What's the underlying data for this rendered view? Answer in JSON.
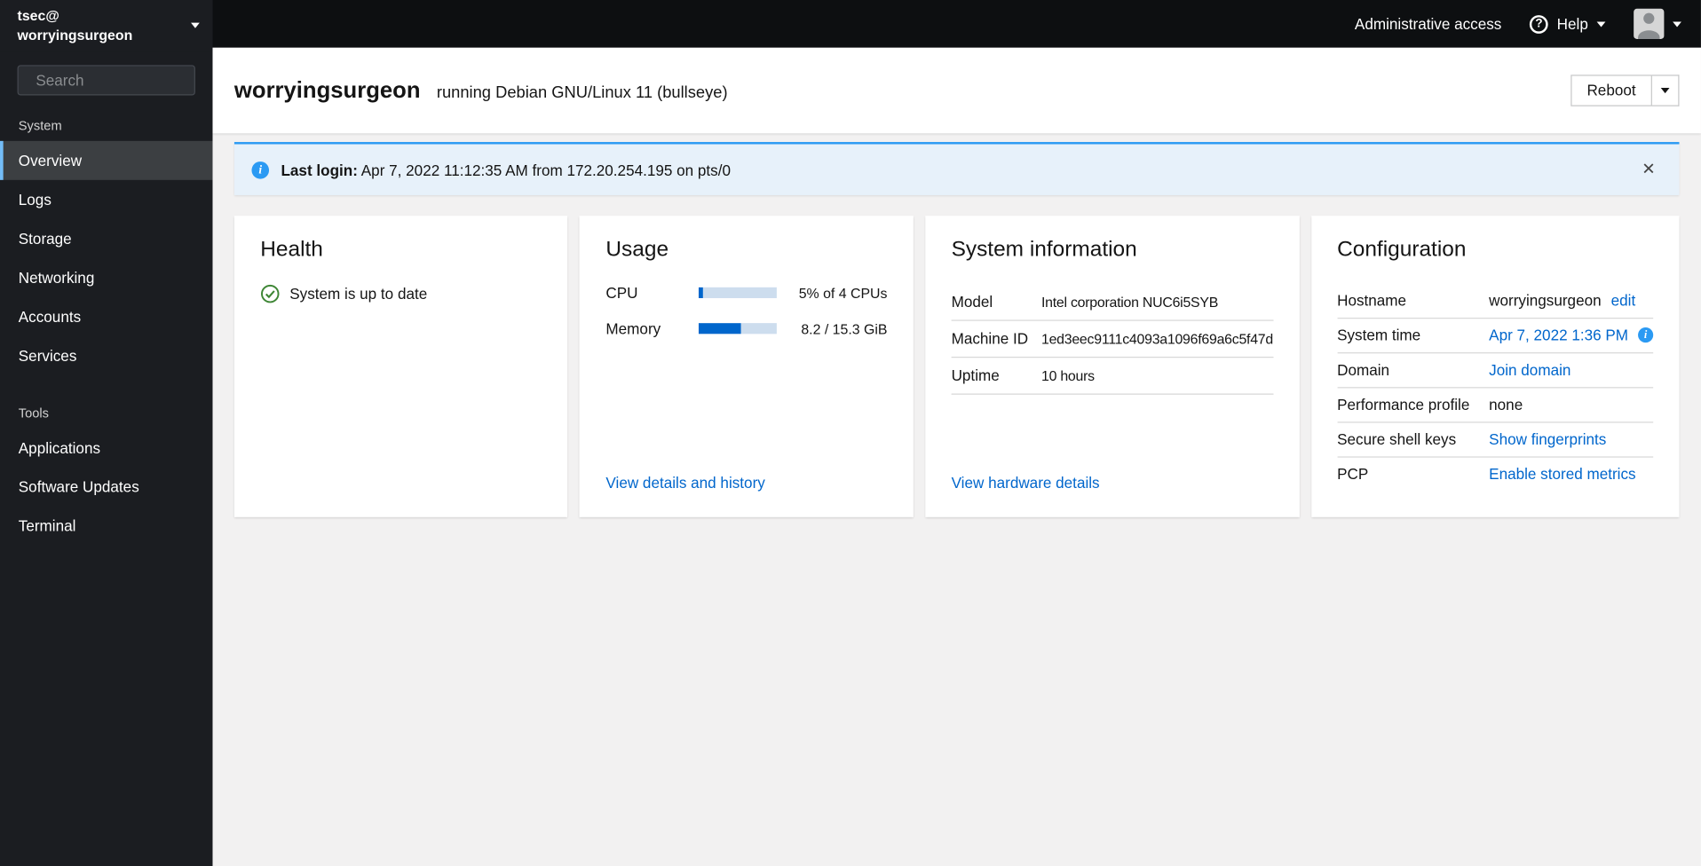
{
  "masthead": {
    "admin_access": "Administrative access",
    "help": "Help"
  },
  "sidebar": {
    "user_line1": "tsec@",
    "user_line2": "worryingsurgeon",
    "search_placeholder": "Search",
    "sections": [
      {
        "label": "System",
        "items": [
          {
            "label": "Overview",
            "active": true
          },
          {
            "label": "Logs"
          },
          {
            "label": "Storage"
          },
          {
            "label": "Networking"
          },
          {
            "label": "Accounts"
          },
          {
            "label": "Services"
          }
        ]
      },
      {
        "label": "Tools",
        "items": [
          {
            "label": "Applications"
          },
          {
            "label": "Software Updates"
          },
          {
            "label": "Terminal"
          }
        ]
      }
    ]
  },
  "header": {
    "hostname": "worryingsurgeon",
    "subtitle": "running Debian GNU/Linux 11 (bullseye)",
    "reboot": "Reboot"
  },
  "alert": {
    "label": "Last login:",
    "message": " Apr 7, 2022 11:12:35 AM from 172.20.254.195 on pts/0"
  },
  "health": {
    "title": "Health",
    "status": "System is up to date"
  },
  "usage": {
    "title": "Usage",
    "rows": [
      {
        "label": "CPU",
        "percent": 5,
        "detail": "5% of 4 CPUs"
      },
      {
        "label": "Memory",
        "percent": 54,
        "detail": "8.2 / 15.3 GiB"
      }
    ],
    "footer_link": "View details and history"
  },
  "system_information": {
    "title": "System information",
    "rows": [
      {
        "label": "Model",
        "value": "Intel corporation NUC6i5SYB"
      },
      {
        "label": "Machine ID",
        "value": "1ed3eec9111c4093a1096f69a6c5f47d"
      },
      {
        "label": "Uptime",
        "value": "10 hours"
      }
    ],
    "footer_link": "View hardware details"
  },
  "configuration": {
    "title": "Configuration",
    "rows": [
      {
        "label": "Hostname",
        "value": "worryingsurgeon",
        "action": "edit"
      },
      {
        "label": "System time",
        "link": "Apr 7, 2022 1:36 PM"
      },
      {
        "label": "Domain",
        "link": "Join domain"
      },
      {
        "label": "Performance profile",
        "value": "none"
      },
      {
        "label": "Secure shell keys",
        "link": "Show fingerprints"
      },
      {
        "label": "PCP",
        "link": "Enable stored metrics"
      }
    ]
  },
  "colors": {
    "link_blue": "#0066cc",
    "info_blue": "#2b9af3",
    "alert_bg": "#e7f1fa",
    "success_green": "#3e8635",
    "nav_active_border": "#73bcf7",
    "sidebar_bg": "#1b1d21",
    "masthead_bg": "#0d0f11"
  }
}
